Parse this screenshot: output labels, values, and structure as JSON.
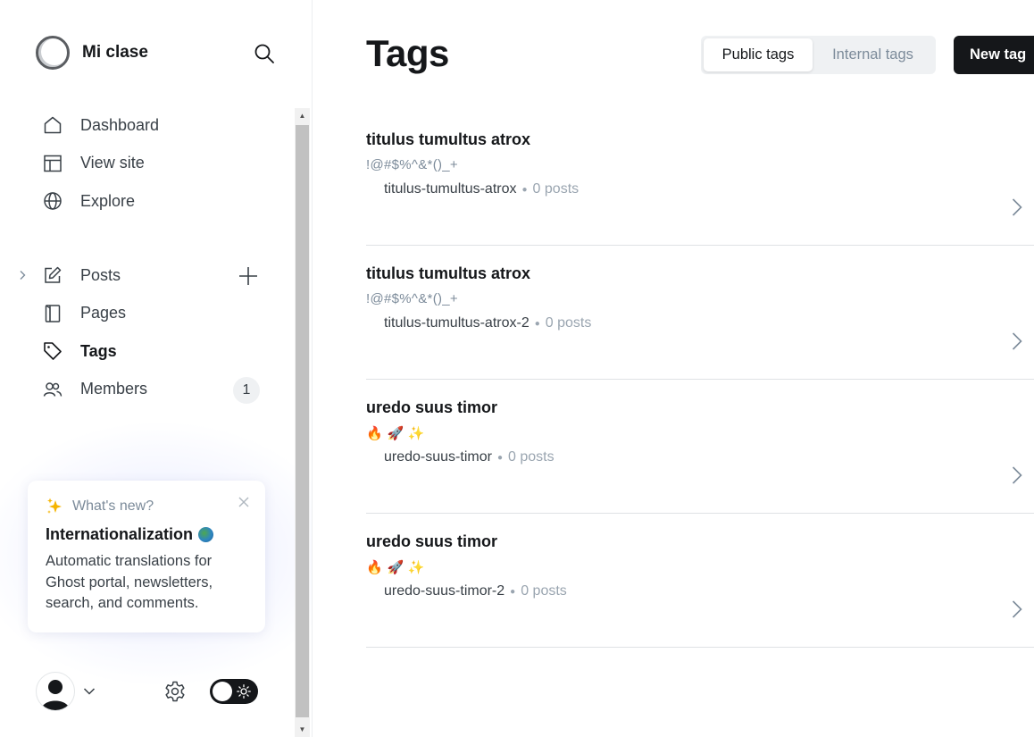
{
  "sidebar": {
    "brand": {
      "name": "Mi clase"
    },
    "nav_primary": [
      {
        "label": "Dashboard",
        "icon": "home-icon"
      },
      {
        "label": "View site",
        "icon": "layout-icon"
      },
      {
        "label": "Explore",
        "icon": "globe-icon"
      }
    ],
    "nav_content": [
      {
        "label": "Posts",
        "icon": "edit-icon",
        "expandable": true,
        "add": true
      },
      {
        "label": "Pages",
        "icon": "page-icon"
      },
      {
        "label": "Tags",
        "icon": "tag-icon",
        "active": true
      },
      {
        "label": "Members",
        "icon": "members-icon",
        "badge": "1"
      }
    ],
    "whats_new": {
      "kicker": "What's new?",
      "title": "Internationalization",
      "body": "Automatic translations for Ghost portal, newsletters, search, and comments."
    }
  },
  "header": {
    "title": "Tags",
    "segments": [
      {
        "label": "Public tags",
        "selected": true
      },
      {
        "label": "Internal tags",
        "selected": false
      }
    ],
    "new_button": "New tag"
  },
  "tags": [
    {
      "name": "titulus tumultus atrox",
      "description": "!@#$%^&*()_+",
      "slug": "titulus-tumultus-atrox",
      "count": "0 posts"
    },
    {
      "name": "titulus tumultus atrox",
      "description": "!@#$%^&*()_+",
      "slug": "titulus-tumultus-atrox-2",
      "count": "0 posts"
    },
    {
      "name": "uredo suus timor",
      "description": "🔥 🚀 ✨",
      "slug": "uredo-suus-timor",
      "count": "0 posts"
    },
    {
      "name": "uredo suus timor",
      "description": "🔥 🚀 ✨",
      "slug": "uredo-suus-timor-2",
      "count": "0 posts"
    }
  ],
  "colors": {
    "primary": "#15171a",
    "muted": "#7c8b9a",
    "divider": "#dfe2e5"
  }
}
